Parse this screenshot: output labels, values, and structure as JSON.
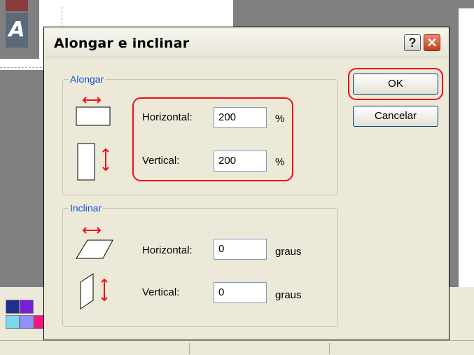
{
  "dialog": {
    "title": "Alongar e inclinar",
    "help_glyph": "?",
    "close_glyph": "✕"
  },
  "stretch": {
    "legend": "Alongar",
    "horizontal_label": "Horizontal:",
    "horizontal_value": "200",
    "horizontal_unit": "%",
    "vertical_label": "Vertical:",
    "vertical_value": "200",
    "vertical_unit": "%"
  },
  "skew": {
    "legend": "Inclinar",
    "horizontal_label": "Horizontal:",
    "horizontal_value": "0",
    "horizontal_unit": "graus",
    "vertical_label": "Vertical:",
    "vertical_value": "0",
    "vertical_unit": "graus"
  },
  "buttons": {
    "ok": "OK",
    "cancel": "Cancelar"
  },
  "background": {
    "tool_glyph": "A",
    "palette_colors": [
      "#1f2f8f",
      "#7a1fd8",
      "#7ad8f0",
      "#9090ff",
      "#ff1080"
    ]
  },
  "colors": {
    "highlight": "#e8101a",
    "legend": "#1c4fd8",
    "arrow": "#e8101a"
  }
}
